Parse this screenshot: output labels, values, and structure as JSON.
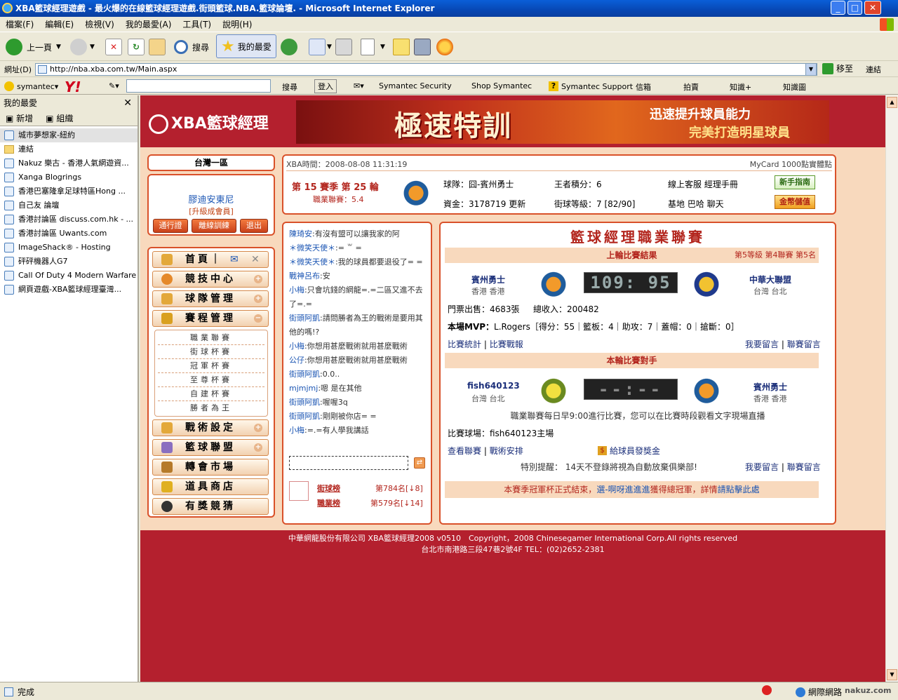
{
  "window": {
    "title": "XBA籃球經理遊戲 - 最火爆的在線籃球經理遊戲.街頭籃球.NBA.籃球論壇. - Microsoft Internet Explorer"
  },
  "menu": [
    "檔案(F)",
    "編輯(E)",
    "檢視(V)",
    "我的最愛(A)",
    "工具(T)",
    "說明(H)"
  ],
  "toolbar": {
    "back": "上一頁",
    "search": "搜尋",
    "favorites": "我的最愛"
  },
  "address": {
    "label": "網址(D)",
    "url": "http://nba.xba.com.tw/Main.aspx",
    "go": "移至",
    "links": "連結"
  },
  "symbar": {
    "symantec": "symantec",
    "search": "搜尋",
    "login": "登入",
    "security": "Symantec Security",
    "shop": "Shop Symantec",
    "support": "Symantec Support",
    "mail": "信箱",
    "auction": "拍賣",
    "knowledge": "知識+",
    "kmap": "知識圖"
  },
  "favorites": {
    "title": "我的最愛",
    "add": "新增",
    "organize": "組織",
    "items": [
      "城市夢想家-紐約",
      "連結",
      "Nakuz 樂古 - 香港人氣網遊資...",
      "Xanga Blogrings",
      "香港巴塞隆拿足球特區Hong ...",
      "自己友 論壇",
      "香港討論區 discuss.com.hk - ...",
      "香港討論區 Uwants.com",
      "ImageShack® - Hosting",
      "砰砰機器人G7",
      "Call Of Duty 4 Modern Warfare ...",
      "網頁遊戲-XBA籃球經理臺灣..."
    ]
  },
  "status": {
    "text": "完成",
    "zone": "網際網路",
    "watermark": "nakuz.com"
  },
  "site": {
    "logo": "XBA籃球經理",
    "banner_title": "極速特訓",
    "banner_line1": "迅速提升球員能力",
    "banner_line2": "完美打造明星球員"
  },
  "user": {
    "server": "台灣一區",
    "name": "膠迪安東尼",
    "level": "[升級成會員]",
    "btn_pass": "通行證",
    "btn_train": "離線訓練",
    "btn_exit": "退出"
  },
  "info": {
    "time": "XBA時間：2008-08-08 11:31:19",
    "mycard": "MyCard 1000點實體點",
    "season": "第 15 賽季 第 25 輪",
    "league": "職業聯賽：5.4",
    "team": "球隊：囧-賓州勇士",
    "king_score": "王者積分：6",
    "service": "線上客服 經理手冊",
    "funds": "資金：3178719 更新",
    "street_level": "街球等級：7 [82/90]",
    "base": "基地 巴哈 聊天",
    "btn_guide": "新手指南",
    "btn_deposit": "金幣儲值"
  },
  "nav": [
    {
      "label": "首頁｜",
      "sub": false
    },
    {
      "label": "競技中心",
      "sub": true
    },
    {
      "label": "球隊管理",
      "sub": true
    },
    {
      "label": "賽程管理",
      "sub": true
    }
  ],
  "schedule_sub": [
    "職業聯賽",
    "街球杯賽",
    "冠軍杯賽",
    "至尊杯賽",
    "自建杯賽",
    "勝者為王"
  ],
  "nav2": [
    "戰術設定",
    "籃球聯盟",
    "轉會市場",
    "道具商店",
    "有獎競猜"
  ],
  "chat": [
    {
      "n": "陳琦安",
      "t": ":有沒有盟可以讓我家的阿"
    },
    {
      "n": "＊微笑天使＊",
      "t": ":= ꒳ ="
    },
    {
      "n": "＊微笑天使＊",
      "t": ":我的球員都要退役了= ="
    },
    {
      "n": "戰神呂布",
      "t": ":安"
    },
    {
      "n": "小梅",
      "t": ":只會坑錢的網龍=.=二區又進不去了=.="
    },
    {
      "n": "街頭阿凱",
      "t": ":請問勝者為王的戰術是要用其他的嗎!?"
    },
    {
      "n": "小梅",
      "t": ":你想用甚麼戰術就用甚麼戰術"
    },
    {
      "n": "公仔",
      "t": ":你想用甚麼戰術就用甚麼戰術"
    },
    {
      "n": "街頭阿凱",
      "t": ":0.0.."
    },
    {
      "n": "mjmjmj",
      "t": ":嗯 是在其他"
    },
    {
      "n": "街頭阿凱",
      "t": ":喔喔3q"
    },
    {
      "n": "街頭阿凱",
      "t": ":剛剛被你店= ="
    },
    {
      "n": "小梅",
      "t": ":=.=有人學我講話"
    }
  ],
  "rank": {
    "street": "街球榜",
    "street_val": "第784名[↓8]",
    "pro": "職業榜",
    "pro_val": "第579名[↓14]"
  },
  "league_panel": {
    "title": "籃球經理職業聯賽",
    "last_result": "上輪比賽結果",
    "last_meta": "第5等級 第4聯賽 第5名",
    "home_team": "賓州勇士",
    "home_loc": "香港 香港",
    "score": "109: 95",
    "away_team": "中華大聯盟",
    "away_loc": "台灣 台北",
    "tickets": "門票出售：4683張",
    "income": "總收入：200482",
    "mvp_label": "本場MVP：",
    "mvp": "L.Rogers［得分：55｜籃板：4｜助攻：7｜蓋帽：0｜搶斷：0］",
    "stats_link": "比賽統計",
    "report_link": "比賽戰報",
    "msg_link": "我要留言",
    "league_msg": "聯賽留言",
    "next_title": "本輪比賽對手",
    "next_home": "fish640123",
    "next_home_loc": "台灣 台北",
    "next_score": "--:--",
    "next_away": "賓州勇士",
    "next_away_loc": "香港 香港",
    "notice": "職業聯賽每日早9:00進行比賽，您可以在比賽時段觀看文字現場直播",
    "venue": "比賽球場：fish640123主場",
    "view_league": "查看聯賽",
    "tactic": "戰術安排",
    "bonus": "給球員發獎金",
    "warn": "特別提醒： 14天不登錄將視為自動放棄俱樂部!",
    "bottom": "本賽季冠軍杯正式結束，",
    "bottom_link": "選-啊呀進進進",
    "bottom2": "獲得總冠軍，詳情",
    "bottom_link2": "請點擊此處"
  },
  "footer": {
    "line1": "中華網龍股份有限公司 XBA籃球經理2008 v0510　Copyright，2008 Chinesegamer International Corp.All rights reserved",
    "line2": "台北市南港路三段47巷2號4F TEL：(02)2652-2381"
  }
}
